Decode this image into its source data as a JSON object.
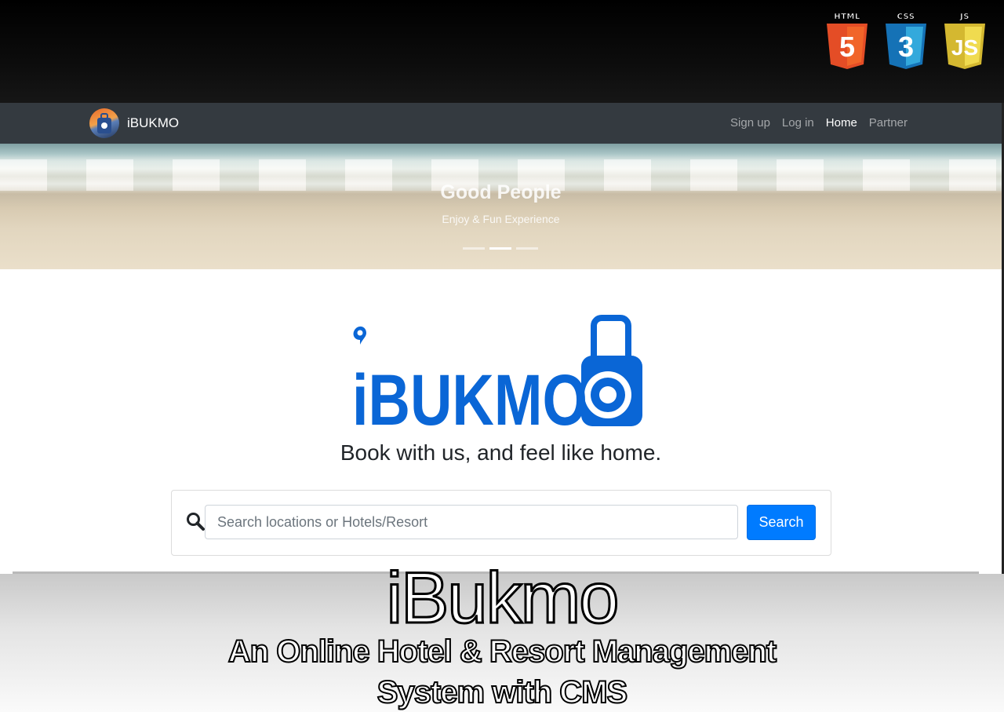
{
  "badges": [
    {
      "caption": "HTML",
      "glyph": "5",
      "color": "#e44d26"
    },
    {
      "caption": "CSS",
      "glyph": "3",
      "color": "#1572b6"
    },
    {
      "caption": "JS",
      "glyph": "JS",
      "color": "#f0db4f"
    }
  ],
  "navbar": {
    "brand": "iBUKMO",
    "links": [
      {
        "label": "Sign up",
        "active": false
      },
      {
        "label": "Log in",
        "active": false
      },
      {
        "label": "Home",
        "active": true
      },
      {
        "label": "Partner",
        "active": false
      }
    ]
  },
  "hero": {
    "title": "Good People",
    "subtitle": "Enjoy & Fun Experience",
    "slide_count": 3,
    "active_slide": 2
  },
  "logo": {
    "text": "iBUKMO",
    "color": "#0a66d6"
  },
  "tagline": "Book with us, and feel like home.",
  "search": {
    "placeholder": "Search locations or Hotels/Resort",
    "button_label": "Search"
  },
  "caption": {
    "title": "iBukmo",
    "line1": "An Online Hotel & Resort Management",
    "line2": "System with CMS"
  },
  "colors": {
    "navbar": "#343a40",
    "accent": "#007bff"
  }
}
